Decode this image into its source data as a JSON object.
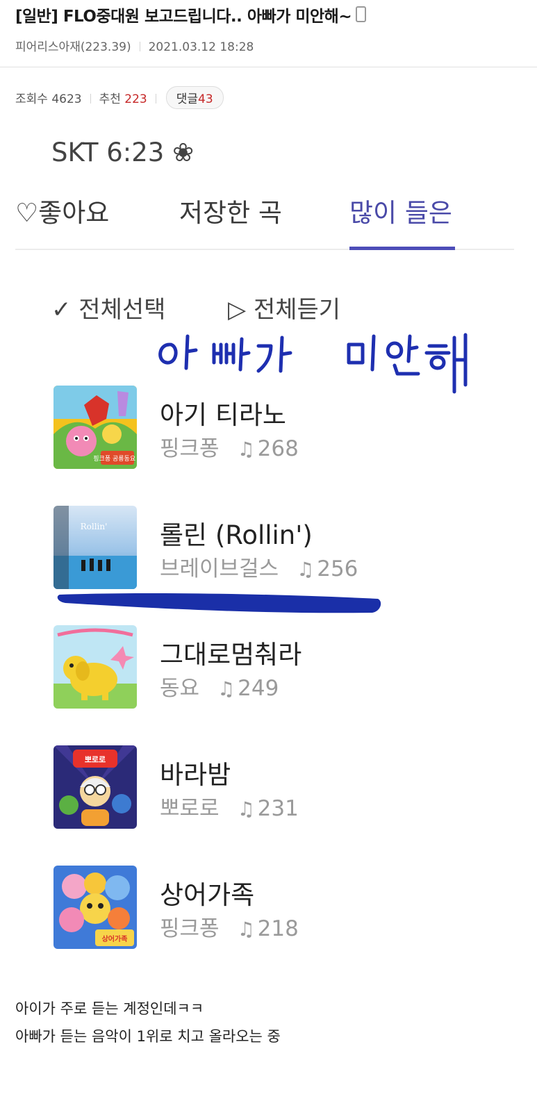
{
  "post": {
    "title": "[일반] FLO중대원 보고드립니다.. 아빠가 미안해~",
    "author": "피어리스아재(223.39)",
    "datetime": "2021.03.12 18:28",
    "views_label": "조회수",
    "views": "4623",
    "recommend_label": "추천",
    "recommend": "223",
    "comments_label": "댓글",
    "comments": "43"
  },
  "screenshot": {
    "status": "SKT 6:23 ❀",
    "tabs": [
      {
        "label": "♡좋아요"
      },
      {
        "label": "저장한 곡"
      },
      {
        "label": "많이 들은"
      }
    ],
    "actions": {
      "select_all": "✓ 전체선택",
      "play_all": "▷ 전체듣기"
    },
    "handwritten": "아 빠가 미안해",
    "songs": [
      {
        "title": "아기 티라노",
        "artist": "핑크퐁",
        "plays": "268"
      },
      {
        "title": "롤린 (Rollin')",
        "artist": "브레이브걸스",
        "plays": "256"
      },
      {
        "title": "그대로멈춰라",
        "artist": "동요",
        "plays": "249"
      },
      {
        "title": "바라밤",
        "artist": "뽀로로",
        "plays": "231"
      },
      {
        "title": "상어가족",
        "artist": "핑크퐁",
        "plays": "218"
      }
    ],
    "note_symbol": "♫",
    "art_labels": {
      "song0": "핑크퐁 공룡동요 2",
      "song1": "Rollin'",
      "song3": "뽀로로",
      "song4": "상어가족"
    }
  },
  "body": {
    "line1": "아이가 주로 듣는 계정인데ㅋㅋ",
    "line2": "아빠가 듣는 음악이 1위로 치고 올라오는 중"
  },
  "colors": {
    "accent_purple": "#4a4aa8",
    "highlight_blue": "#1a2fa8",
    "count_red": "#c62828"
  }
}
